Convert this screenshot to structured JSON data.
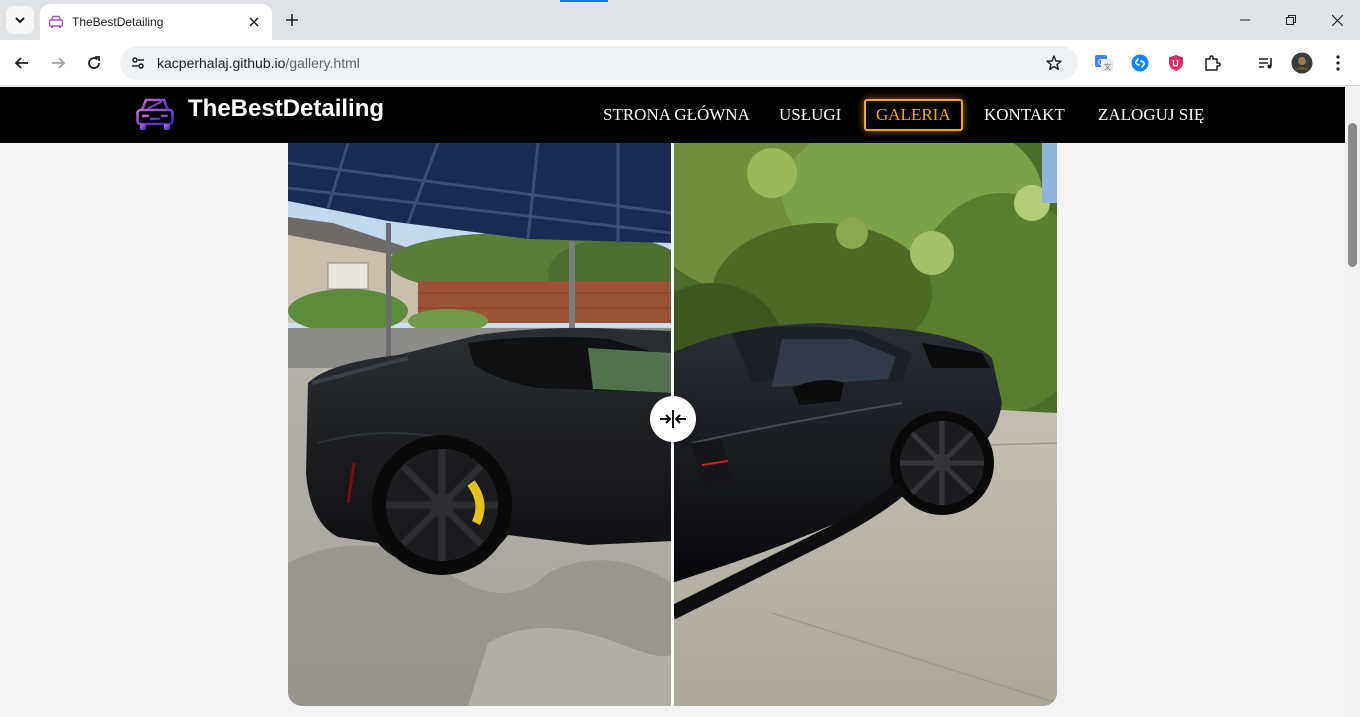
{
  "browser": {
    "tab_title": "TheBestDetailing",
    "url_host": "kacperhalaj.github.io",
    "url_path": "/gallery.html"
  },
  "site": {
    "brand_name": "TheBestDetailing",
    "nav": {
      "home": "STRONA GŁÓWNA",
      "services": "USŁUGI",
      "gallery": "GALERIA",
      "contact": "KONTAKT",
      "login": "ZALOGUJ SIĘ"
    },
    "active_nav": "gallery"
  },
  "gallery": {
    "comparison_split": 0.5
  },
  "colors": {
    "header_bg": "#000000",
    "accent": "#f5a623",
    "page_bg": "#f3f3f3",
    "logo_gradient": [
      "#c86dd7",
      "#3023ae"
    ]
  }
}
